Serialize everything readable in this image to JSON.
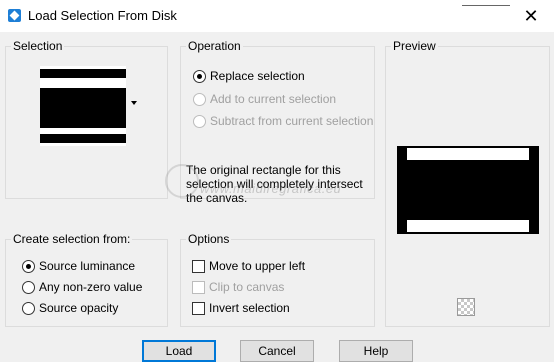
{
  "window": {
    "title": "Load Selection From Disk",
    "close_glyph": "✕",
    "icon": "app-icon"
  },
  "selection": {
    "label": "Selection"
  },
  "operation": {
    "label": "Operation",
    "options": [
      {
        "label": "Replace selection",
        "checked": true,
        "enabled": true
      },
      {
        "label": "Add to current selection",
        "checked": false,
        "enabled": false
      },
      {
        "label": "Subtract from current selection",
        "checked": false,
        "enabled": false
      }
    ],
    "info": "The original rectangle for this selection will completely intersect the canvas."
  },
  "preview": {
    "label": "Preview"
  },
  "create_from": {
    "label": "Create selection from:",
    "options": [
      {
        "label": "Source luminance",
        "checked": true
      },
      {
        "label": "Any non-zero value",
        "checked": false
      },
      {
        "label": "Source opacity",
        "checked": false
      }
    ]
  },
  "options": {
    "label": "Options",
    "items": [
      {
        "label": "Move to upper left",
        "checked": false,
        "enabled": true
      },
      {
        "label": "Clip to canvas",
        "checked": false,
        "enabled": false
      },
      {
        "label": "Invert selection",
        "checked": false,
        "enabled": true
      }
    ]
  },
  "buttons": {
    "load": "Load",
    "cancel": "Cancel",
    "help": "Help"
  },
  "watermark": {
    "text": "www.maidiregrafica.eu",
    "signature": "Pinuccia"
  },
  "colors": {
    "accent": "#0078d7",
    "dialog_bg": "#f0f0f0",
    "disabled_text": "#a0a0a0"
  }
}
